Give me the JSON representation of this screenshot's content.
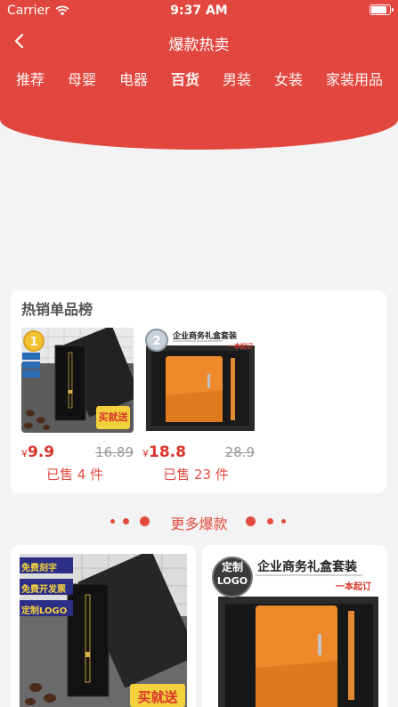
{
  "status": {
    "carrier": "Carrier",
    "time": "9:37 AM",
    "battery_level": 0.9
  },
  "nav": {
    "title": "爆款热卖"
  },
  "tabs": [
    {
      "label": "推荐"
    },
    {
      "label": "母婴"
    },
    {
      "label": "电器"
    },
    {
      "label": "百货",
      "active": true
    },
    {
      "label": "男装"
    },
    {
      "label": "女装"
    },
    {
      "label": "家装用品"
    }
  ],
  "hot": {
    "title": "热销单品榜",
    "products": [
      {
        "rank": "1",
        "currency": "¥",
        "price": "9.9",
        "old_price": "16.89",
        "sold": "已售 4 件",
        "badge": "买就送"
      },
      {
        "rank": "2",
        "currency": "¥",
        "price": "18.8",
        "old_price": "28.9",
        "sold": "已售 23 件",
        "banner": "企业商务礼盒套装",
        "banner_sub": "一本起订"
      }
    ]
  },
  "more": {
    "label": "更多爆款"
  },
  "grid": [
    {
      "tags": [
        "免费刻字",
        "免费开发票",
        "定制LOGO"
      ],
      "badge": "买就送"
    },
    {
      "banner": "企业商务礼盒套装",
      "banner_sub": "一本起订",
      "logo_top": "定制",
      "logo_bottom": "LOGO"
    }
  ],
  "colors": {
    "brand_red": "#e2473f",
    "price_red": "#d9342b",
    "background": "#f3f3f3"
  }
}
